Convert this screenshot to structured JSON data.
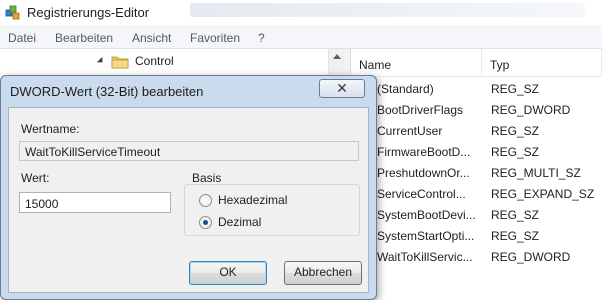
{
  "window": {
    "title": "Registrierungs-Editor",
    "app_icon": "registry-editor-icon"
  },
  "menu": [
    {
      "label": "Datei"
    },
    {
      "label": "Bearbeiten"
    },
    {
      "label": "Ansicht"
    },
    {
      "label": "Favoriten"
    },
    {
      "label": "?"
    }
  ],
  "tree": {
    "selected_key": "Control",
    "expander_icon": "expanded-triangle-icon",
    "folder_icon": "folder-icon"
  },
  "values_table": {
    "columns": [
      "Name",
      "Typ"
    ],
    "rows": [
      {
        "name": "(Standard)",
        "type": "REG_SZ"
      },
      {
        "name": "BootDriverFlags",
        "type": "REG_DWORD"
      },
      {
        "name": "CurrentUser",
        "type": "REG_SZ"
      },
      {
        "name": "FirmwareBootD...",
        "type": "REG_SZ"
      },
      {
        "name": "PreshutdownOr...",
        "type": "REG_MULTI_SZ"
      },
      {
        "name": "ServiceControl...",
        "type": "REG_EXPAND_SZ"
      },
      {
        "name": "SystemBootDevi...",
        "type": "REG_SZ"
      },
      {
        "name": "SystemStartOpti...",
        "type": "REG_SZ"
      },
      {
        "name": "WaitToKillServic...",
        "type": "REG_DWORD"
      }
    ]
  },
  "dialog": {
    "title": "DWORD-Wert (32-Bit) bearbeiten",
    "close_label": "✕",
    "value_name_label": "Wertname:",
    "value_name": "WaitToKillServiceTimeout",
    "value_label": "Wert:",
    "value": "15000",
    "base_label": "Basis",
    "base_options": [
      {
        "label": "Hexadezimal",
        "checked": false
      },
      {
        "label": "Dezimal",
        "checked": true
      }
    ],
    "ok_label": "OK",
    "cancel_label": "Abbrechen"
  },
  "colors": {
    "dialog_frame": "#c9dbed",
    "dialog_client": "#f0f0f0",
    "menubar": "#f4f6fa",
    "default_button_border": "#3c7fb1"
  }
}
